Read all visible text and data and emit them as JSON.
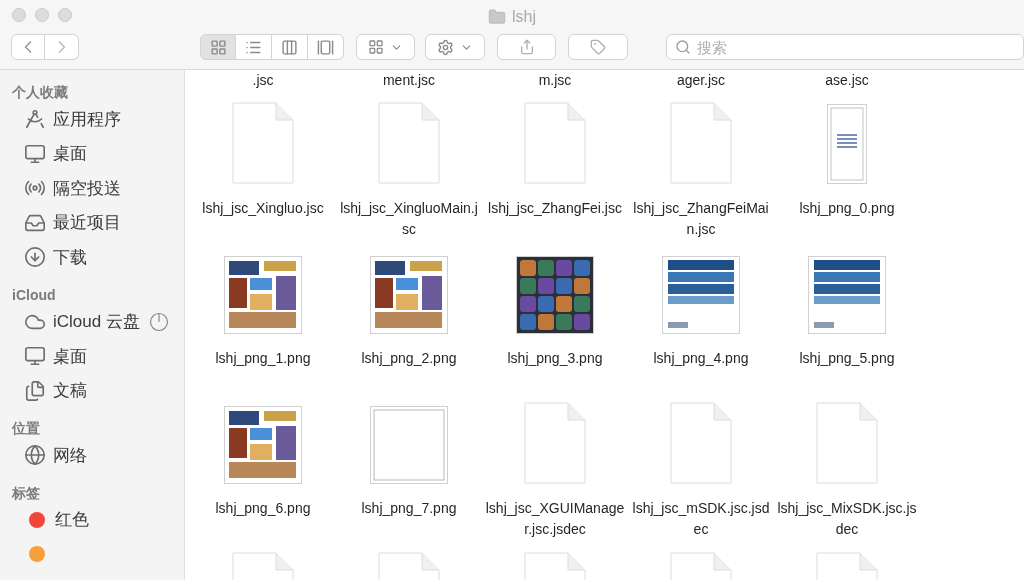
{
  "window": {
    "title": "lshj"
  },
  "toolbar": {
    "view_buttons": [
      {
        "kind": "icons",
        "selected": true
      },
      {
        "kind": "list",
        "selected": false
      },
      {
        "kind": "columns",
        "selected": false
      },
      {
        "kind": "gallery",
        "selected": false
      }
    ],
    "search": {
      "placeholder": "搜索"
    }
  },
  "sidebar": {
    "sections": [
      {
        "title": "个人收藏",
        "items": [
          {
            "kind": "applications",
            "label": "应用程序"
          },
          {
            "kind": "desktop",
            "label": "桌面"
          },
          {
            "kind": "airdrop",
            "label": "隔空投送"
          },
          {
            "kind": "recents",
            "label": "最近项目"
          },
          {
            "kind": "downloads",
            "label": "下载"
          }
        ]
      },
      {
        "title": "iCloud",
        "items": [
          {
            "kind": "icloud",
            "label": "iCloud 云盘"
          },
          {
            "kind": "desktop",
            "label": "桌面"
          },
          {
            "kind": "documents",
            "label": "文稿"
          }
        ]
      },
      {
        "title": "位置",
        "items": [
          {
            "kind": "network",
            "label": "网络"
          }
        ]
      },
      {
        "title": "标签",
        "items": [
          {
            "kind": "tag",
            "label": "红色",
            "color": "#f0463c"
          },
          {
            "kind": "tag",
            "color": "#f5a03a"
          }
        ]
      }
    ]
  },
  "files": {
    "rows": [
      [
        {
          "kind": "cut",
          "name": ".jsc"
        },
        {
          "kind": "cut",
          "name": "ment.jsc"
        },
        {
          "kind": "cut",
          "name": "m.jsc"
        },
        {
          "kind": "cut",
          "name": "ager.jsc"
        },
        {
          "kind": "cut",
          "name": "ase.jsc"
        }
      ],
      [
        {
          "kind": "document",
          "name": "lshj_jsc_Xingluo.jsc"
        },
        {
          "kind": "document",
          "name": "lshj_jsc_XingluoMain.jsc"
        },
        {
          "kind": "document",
          "name": "lshj_jsc_ZhangFei.jsc"
        },
        {
          "kind": "document",
          "name": "lshj_jsc_ZhangFeiMain.jsc"
        },
        {
          "kind": "text-page",
          "name": "lshj_png_0.png"
        }
      ],
      [
        {
          "kind": "collage",
          "name": "lshj_png_1.png"
        },
        {
          "kind": "collage",
          "name": "lshj_png_2.png"
        },
        {
          "kind": "tile-grid",
          "name": "lshj_png_3.png"
        },
        {
          "kind": "blue-strips",
          "name": "lshj_png_4.png"
        },
        {
          "kind": "blue-strips",
          "name": "lshj_png_5.png"
        }
      ],
      [
        {
          "kind": "collage",
          "name": "lshj_png_6.png"
        },
        {
          "kind": "blank-image",
          "name": "lshj_png_7.png"
        },
        {
          "kind": "document",
          "name": "lshj_jsc_XGUIManager.jsc.jsdec"
        },
        {
          "kind": "document",
          "name": "lshj_jsc_mSDK.jsc.jsdec"
        },
        {
          "kind": "document",
          "name": "lshj_jsc_MixSDK.jsc.jsdec"
        }
      ],
      [
        {
          "kind": "document"
        },
        {
          "kind": "document"
        },
        {
          "kind": "document"
        },
        {
          "kind": "document"
        },
        {
          "kind": "document"
        }
      ]
    ]
  }
}
